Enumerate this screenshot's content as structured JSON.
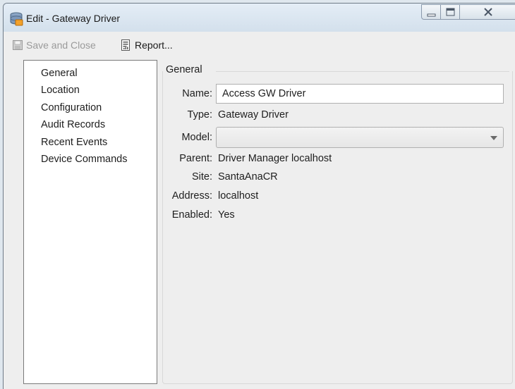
{
  "window": {
    "title": "Edit - Gateway Driver"
  },
  "toolbar": {
    "save_label": "Save and Close",
    "report_label": "Report..."
  },
  "nav": {
    "items": [
      {
        "label": "General",
        "selected": true
      },
      {
        "label": "Location"
      },
      {
        "label": "Configuration"
      },
      {
        "label": "Audit Records"
      },
      {
        "label": "Recent Events"
      },
      {
        "label": "Device Commands"
      }
    ]
  },
  "general": {
    "group_title": "General",
    "fields": {
      "name_label": "Name:",
      "name_value": "Access GW Driver",
      "type_label": "Type:",
      "type_value": "Gateway Driver",
      "model_label": "Model:",
      "model_value": "",
      "parent_label": "Parent:",
      "parent_value": "Driver Manager localhost",
      "site_label": "Site:",
      "site_value": "SantaAnaCR",
      "address_label": "Address:",
      "address_value": "localhost",
      "enabled_label": "Enabled:",
      "enabled_value": "Yes"
    }
  },
  "icons": {
    "app": "database-drive-icon",
    "save": "floppy-disk-icon",
    "report": "report-document-icon",
    "minimize": "minimize-icon",
    "maximize": "maximize-icon",
    "close": "close-icon",
    "dropdown": "chevron-down-icon"
  }
}
